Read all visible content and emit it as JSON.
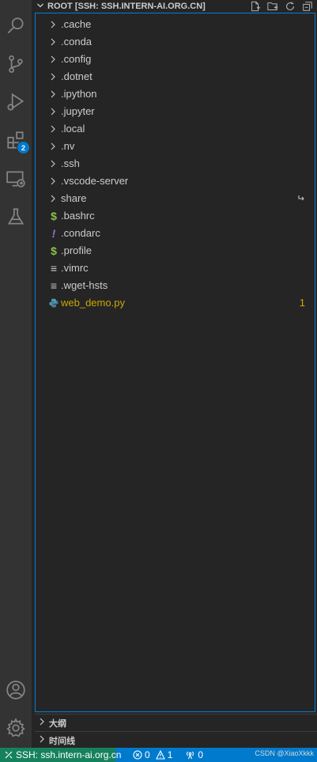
{
  "explorer": {
    "title": "ROOT [SSH: SSH.INTERN-AI.ORG.CN]",
    "items": [
      {
        "label": ".cache",
        "type": "folder"
      },
      {
        "label": ".conda",
        "type": "folder"
      },
      {
        "label": ".config",
        "type": "folder"
      },
      {
        "label": ".dotnet",
        "type": "folder"
      },
      {
        "label": ".ipython",
        "type": "folder"
      },
      {
        "label": ".jupyter",
        "type": "folder"
      },
      {
        "label": ".local",
        "type": "folder"
      },
      {
        "label": ".nv",
        "type": "folder"
      },
      {
        "label": ".ssh",
        "type": "folder"
      },
      {
        "label": ".vscode-server",
        "type": "folder"
      },
      {
        "label": "share",
        "type": "folder",
        "link_icon": "symlink-icon"
      },
      {
        "label": ".bashrc",
        "type": "file",
        "icon": "$",
        "icon_color": "#8dc149"
      },
      {
        "label": ".condarc",
        "type": "file",
        "icon": "!",
        "icon_color": "#a074c4"
      },
      {
        "label": ".profile",
        "type": "file",
        "icon": "$",
        "icon_color": "#8dc149"
      },
      {
        "label": ".vimrc",
        "type": "file",
        "icon": "≡",
        "icon_color": "#cccccc"
      },
      {
        "label": ".wget-hsts",
        "type": "file",
        "icon": "≡",
        "icon_color": "#cccccc"
      },
      {
        "label": "web_demo.py",
        "type": "file",
        "icon": "python-icon",
        "icon_color": "#519aba",
        "label_color": "#cca700",
        "problems": "1"
      }
    ]
  },
  "sections": {
    "outline": "大纲",
    "timeline": "时间线"
  },
  "activity": {
    "extensions_badge": "2"
  },
  "statusbar": {
    "remote": "SSH: ssh.intern-ai.org.cn",
    "errors": "0",
    "warnings": "1",
    "ports": "0",
    "watermark": "CSDN @XiaoXkkk"
  },
  "colors": {
    "accent": "#007acc",
    "remote_bg": "#16825d",
    "warning_text": "#cca700"
  }
}
